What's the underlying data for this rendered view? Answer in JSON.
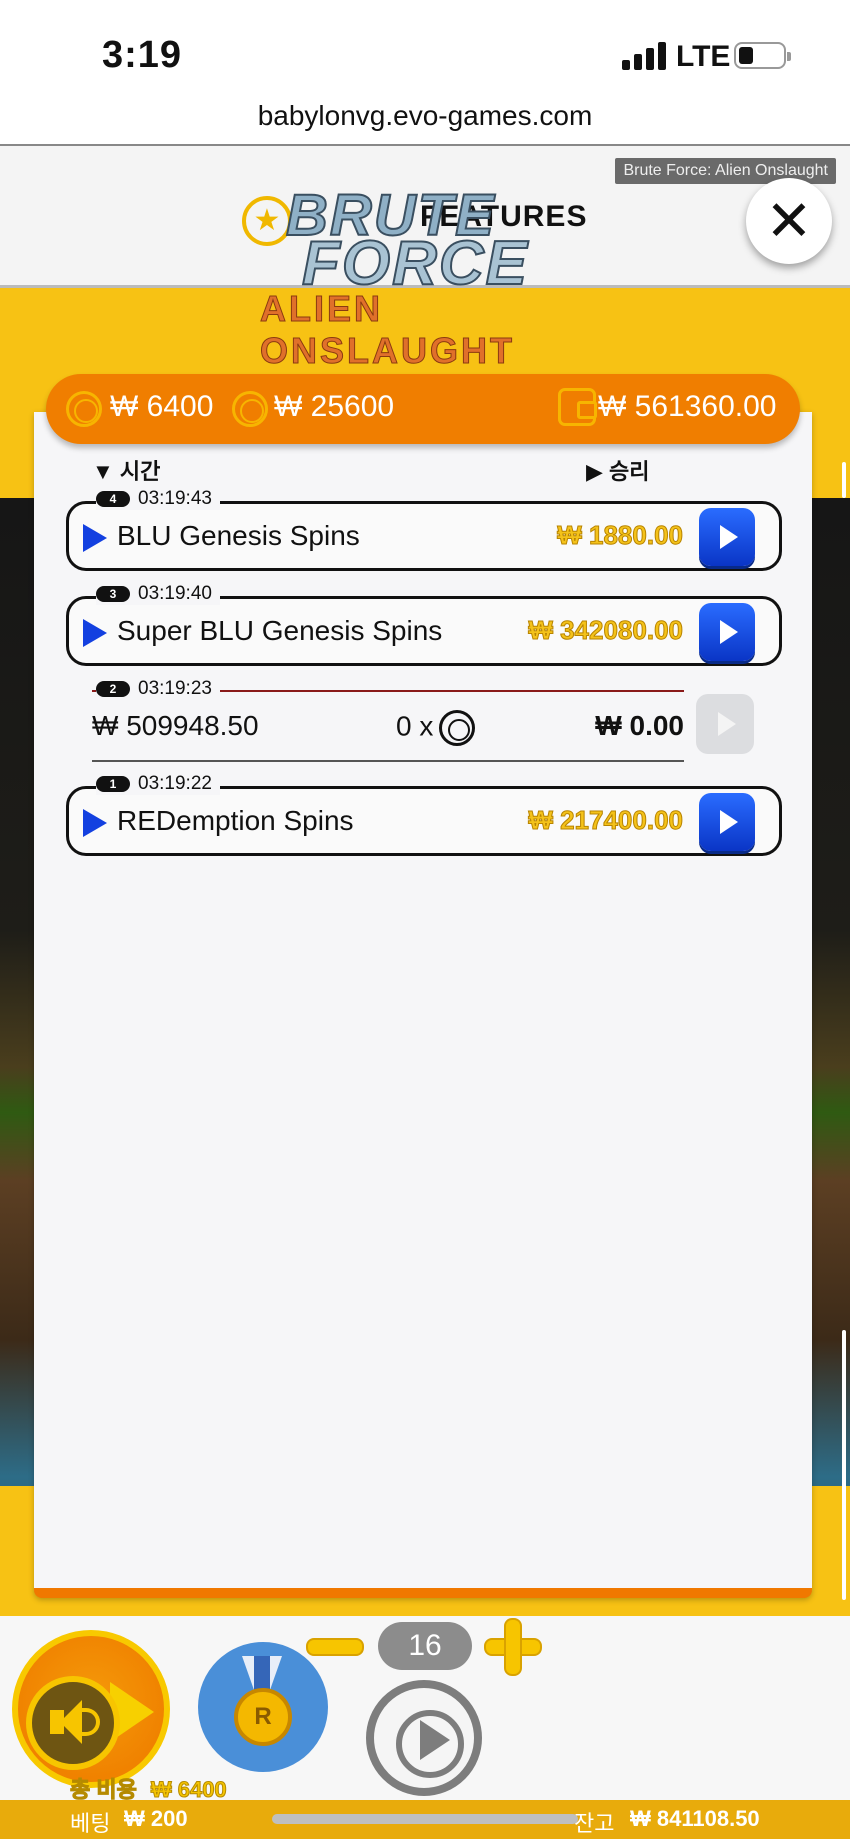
{
  "status_bar": {
    "time": "3:19",
    "network": "LTE"
  },
  "browser": {
    "url": "babylonvg.evo-games.com"
  },
  "game": {
    "tag": "Brute Force: Alien Onslaught",
    "logo_line1": "BRUTE",
    "logo_line2": "FORCE",
    "logo_line3": "ALIEN ONSLAUGHT",
    "features_label": "FEATURES",
    "close_label": "✕"
  },
  "cost_bar": {
    "cost1": "₩ 6400",
    "cost2": "₩ 25600",
    "balance": "₩ 561360.00"
  },
  "columns": {
    "time": "시간",
    "win": "승리"
  },
  "history": [
    {
      "badge": "4",
      "time": "03:19:43",
      "name": "BLU Genesis Spins",
      "amount": "₩ 1880.00"
    },
    {
      "badge": "3",
      "time": "03:19:40",
      "name": "Super BLU Genesis Spins",
      "amount": "₩ 342080.00"
    },
    {
      "badge": "2",
      "time": "03:19:23",
      "bet": "₩ 509948.50",
      "multiplier": "0 x",
      "amount": "₩ 0.00"
    },
    {
      "badge": "1",
      "time": "03:19:22",
      "name": "REDemption Spins",
      "amount": "₩ 217400.00"
    }
  ],
  "controls": {
    "counter": "16",
    "total_bet_label": "총 비용",
    "total_bet_value": "₩ 6400",
    "medal_label": "R"
  },
  "footer": {
    "bet_label": "베팅",
    "bet_value": "₩ 200",
    "balance_label": "잔고",
    "balance_value": "₩ 841108.50"
  },
  "colors": {
    "accent_orange": "#f07e00",
    "game_yellow": "#f7c214",
    "play_blue": "#1340e0",
    "win_gold": "#f4c21a"
  }
}
